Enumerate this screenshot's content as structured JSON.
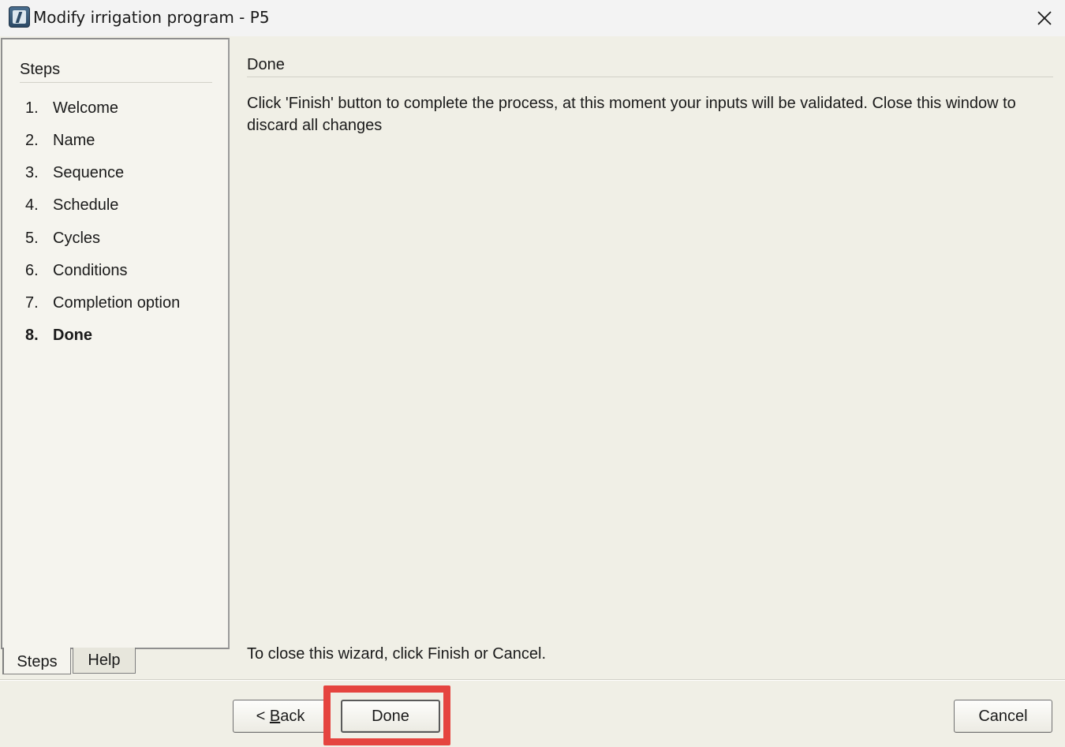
{
  "window": {
    "title": "Modify irrigation program - P5"
  },
  "sidebar": {
    "heading": "Steps",
    "steps": [
      {
        "num": "1.",
        "label": "Welcome",
        "active": false
      },
      {
        "num": "2.",
        "label": "Name",
        "active": false
      },
      {
        "num": "3.",
        "label": "Sequence",
        "active": false
      },
      {
        "num": "4.",
        "label": "Schedule",
        "active": false
      },
      {
        "num": "5.",
        "label": "Cycles",
        "active": false
      },
      {
        "num": "6.",
        "label": "Conditions",
        "active": false
      },
      {
        "num": "7.",
        "label": "Completion option",
        "active": false
      },
      {
        "num": "8.",
        "label": "Done",
        "active": true
      }
    ],
    "tabs": [
      {
        "label": "Steps",
        "selected": true
      },
      {
        "label": "Help",
        "selected": false
      }
    ]
  },
  "main": {
    "title": "Done",
    "description": "Click 'Finish' button to complete the process, at this moment your inputs will be validated. Close this window to discard all changes",
    "close_hint": "To close this wizard, click Finish or Cancel."
  },
  "buttons": {
    "back_prefix": "< ",
    "back_mnemonic": "B",
    "back_rest": "ack",
    "done": "Done",
    "cancel": "Cancel"
  },
  "colors": {
    "highlight": "#e5443f",
    "background": "#f0efe6"
  },
  "icons": {
    "app": "app-icon",
    "close": "close-icon"
  }
}
